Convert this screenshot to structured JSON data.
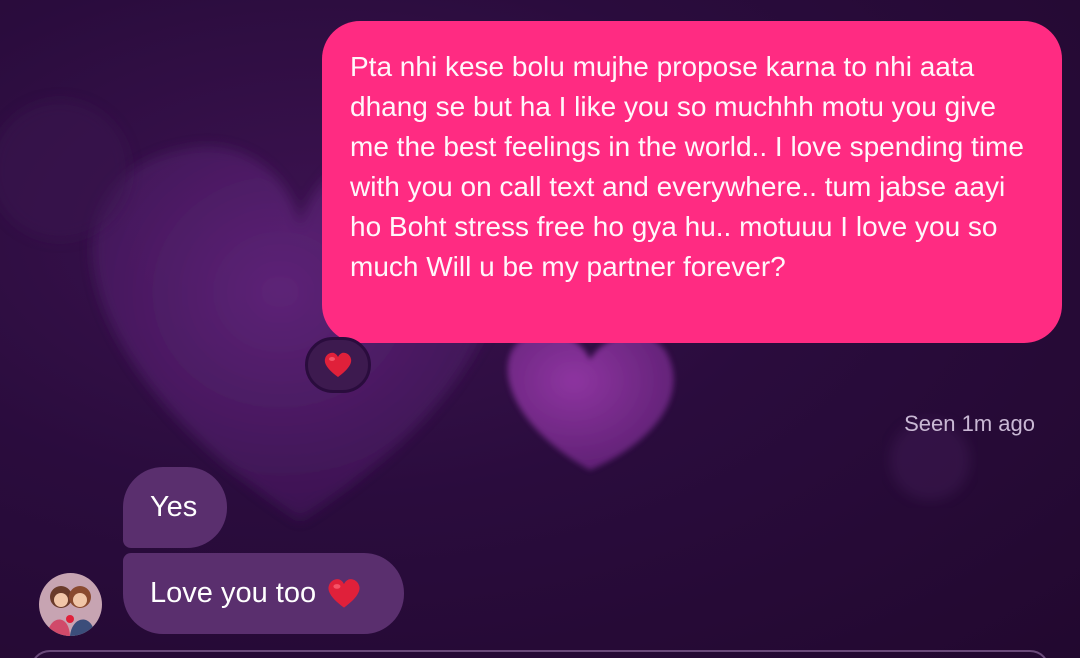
{
  "chat": {
    "outgoing_message": "Pta nhi kese bolu mujhe propose karna to nhi aata dhang se but ha I like you so muchhh motu you give me the best feelings in the world.. I love spending time with you on call text and everywhere.. tum jabse aayi ho Boht stress free ho gya hu.. motuuu I love you so much Will u be my partner forever?",
    "reaction_icon": "red-heart",
    "seen_status": "Seen 1m ago",
    "incoming_messages": [
      {
        "text": "Yes",
        "emoji": null
      },
      {
        "text": "Love you too",
        "emoji": "red-heart"
      }
    ]
  },
  "colors": {
    "background": "#2a0c3d",
    "outgoing_bubble": "#ff2b82",
    "incoming_bubble": "#5a2f6e",
    "heart": "#e0203a"
  }
}
